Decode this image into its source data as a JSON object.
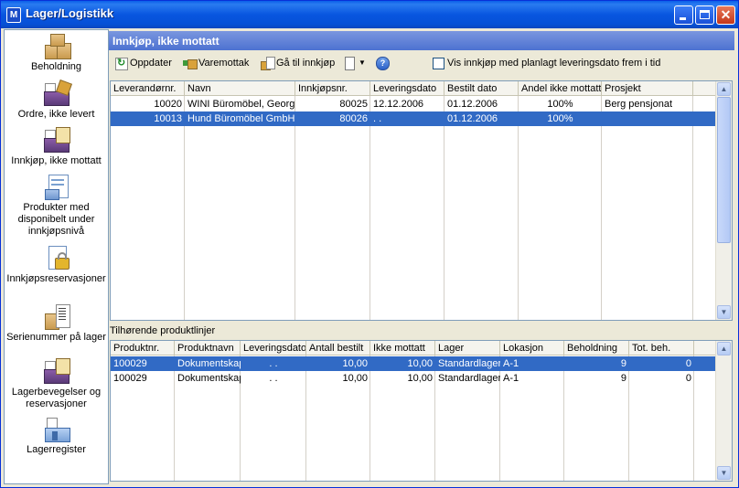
{
  "window": {
    "title": "Lager/Logistikk"
  },
  "sidebar": {
    "items": [
      {
        "label": "Beholdning",
        "icon": "boxes-icon"
      },
      {
        "label": "Ordre, ikke levert",
        "icon": "cash-register-icon"
      },
      {
        "label": "Innkjøp, ikke mottatt",
        "icon": "purchase-doc-icon"
      },
      {
        "label": "Produkter med disponibelt under innkjøpsnivå",
        "icon": "cash-register-icon"
      },
      {
        "label": "Innkjøpsreservasjoner",
        "icon": "lock-doc-icon"
      },
      {
        "label": "Serienummer på lager",
        "icon": "serial-doc-icon"
      },
      {
        "label": "Lagerbevegelser og reservasjoner",
        "icon": "movement-icon"
      },
      {
        "label": "Lagerregister",
        "icon": "warehouse-icon"
      }
    ]
  },
  "header": {
    "title": "Innkjøp, ikke mottatt"
  },
  "toolbar": {
    "refresh_label": "Oppdater",
    "receive_label": "Varemottak",
    "goto_label": "Gå til innkjøp",
    "show_planned_label": "Vis innkjøp med planlagt leveringsdato frem i tid",
    "show_planned_checked": false
  },
  "purchases": {
    "columns": [
      "Leverandørnr.",
      "Navn",
      "Innkjøpsnr.",
      "Leveringsdato",
      "Bestilt dato",
      "Andel ikke mottatt",
      "Prosjekt"
    ],
    "rows": [
      {
        "supplier_no": "10020",
        "name": "WINI Büromöbel, Georg S",
        "purchase_no": "80025",
        "delivery_date": "12.12.2006",
        "ordered_date": "01.12.2006",
        "share": "100%",
        "project": "Berg pensjonat",
        "selected": false
      },
      {
        "supplier_no": "10013",
        "name": "Hund Büromöbel GmbH,",
        "purchase_no": "80026",
        "delivery_date": ". .",
        "ordered_date": "01.12.2006",
        "share": "100%",
        "project": "",
        "selected": true
      }
    ]
  },
  "lines": {
    "title": "Tilhørende produktlinjer",
    "columns": [
      "Produktnr.",
      "Produktnavn",
      "Leveringsdato",
      "Antall bestilt",
      "Ikke mottatt",
      "Lager",
      "Lokasjon",
      "Beholdning",
      "Tot. beh."
    ],
    "rows": [
      {
        "product_no": "100029",
        "product_name": "Dokumentskap",
        "delivery_date": ". .",
        "ordered": "10,00",
        "not_received": "10,00",
        "warehouse": "Standardlager",
        "location": "A-1",
        "stock": "9",
        "total": "0",
        "selected": true
      },
      {
        "product_no": "100029",
        "product_name": "Dokumentskap",
        "delivery_date": ". .",
        "ordered": "10,00",
        "not_received": "10,00",
        "warehouse": "Standardlager",
        "location": "A-1",
        "stock": "9",
        "total": "0",
        "selected": false
      }
    ]
  }
}
